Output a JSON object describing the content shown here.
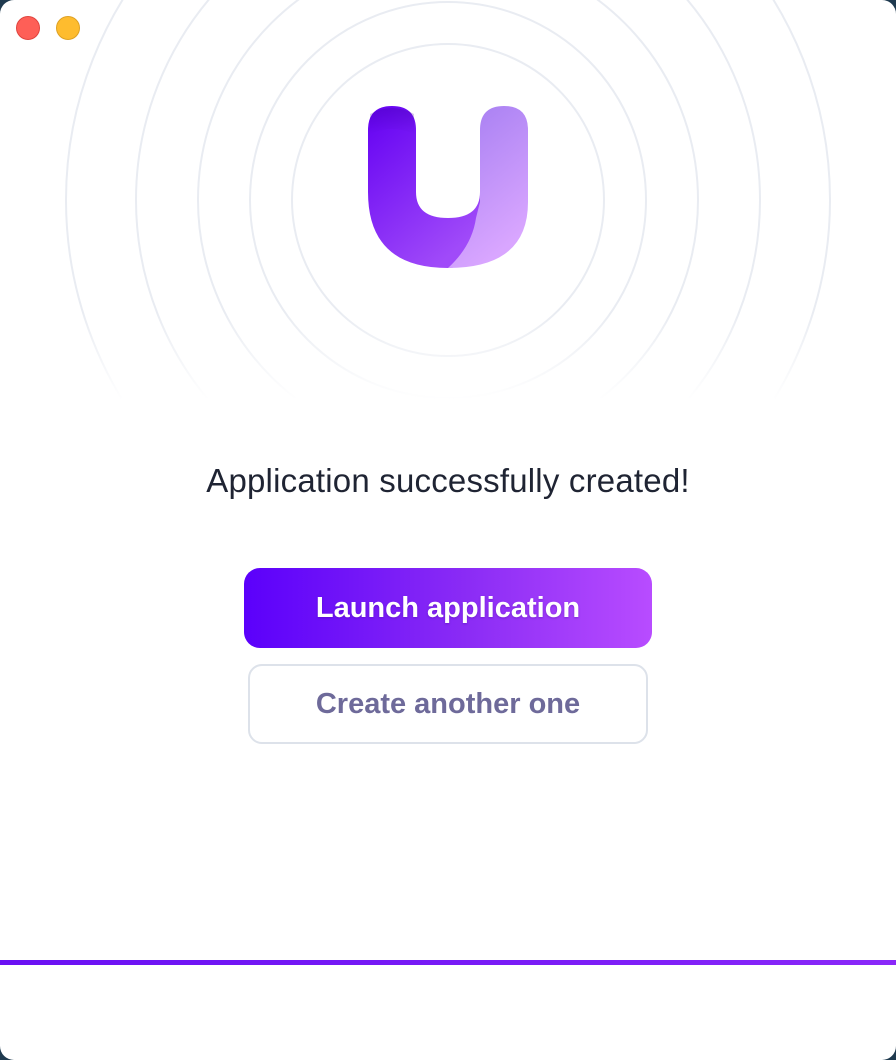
{
  "window": {
    "controls": [
      "close",
      "minimize"
    ]
  },
  "logo": {
    "icon": "u-logo-icon",
    "colors": {
      "left_stroke_top": "#6a00f4",
      "left_stroke_bottom": "#a64bff",
      "right_stroke_top": "#a97cf3",
      "right_stroke_bottom": "#d6a2ff"
    }
  },
  "main": {
    "headline": "Application successfully created!",
    "primary_button": "Launch application",
    "secondary_button": "Create another one"
  },
  "colors": {
    "accent_start": "#5b00fb",
    "accent_end": "#b84cff",
    "headline": "#1f2433",
    "secondary_text": "#6e6a9a",
    "secondary_border": "#dde2ea",
    "progress_bar": "#6a10f3"
  }
}
